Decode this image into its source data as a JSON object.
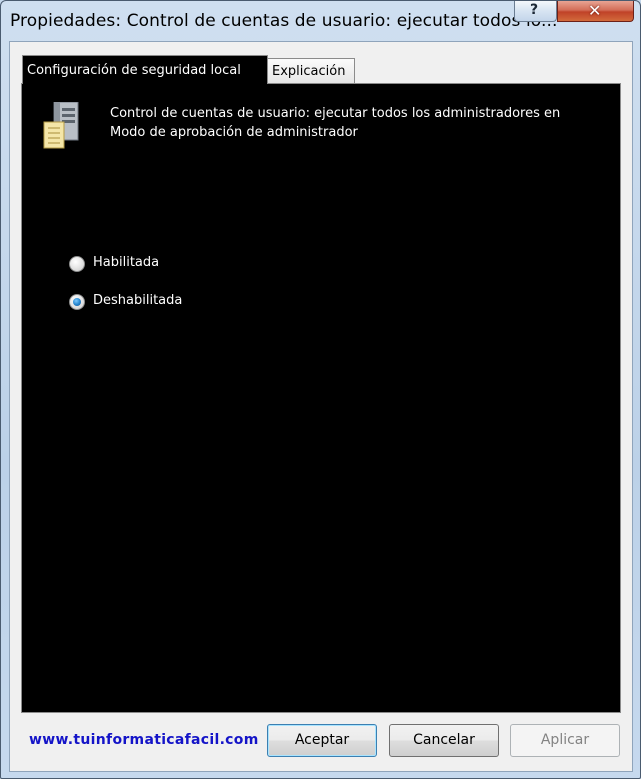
{
  "window": {
    "title": "Propiedades: Control de cuentas de usuario: ejecutar todos lo...",
    "help_label": "?",
    "close_label": "✕"
  },
  "tabs": [
    {
      "label": "Configuración de seguridad local",
      "active": true
    },
    {
      "label": "Explicación",
      "active": false
    }
  ],
  "policy": {
    "icon": "server-icon",
    "description": "Control de cuentas de usuario: ejecutar todos los administradores en Modo de aprobación de administrador"
  },
  "options": [
    {
      "label": "Habilitada",
      "checked": false
    },
    {
      "label": "Deshabilitada",
      "checked": true
    }
  ],
  "footer": {
    "watermark": "www.tuinformaticafacil.com",
    "buttons": {
      "ok": "Aceptar",
      "cancel": "Cancelar",
      "apply": "Aplicar"
    }
  },
  "colors": {
    "panel_bg": "#000000",
    "watermark": "#1414c8",
    "close_button": "#c04228"
  }
}
